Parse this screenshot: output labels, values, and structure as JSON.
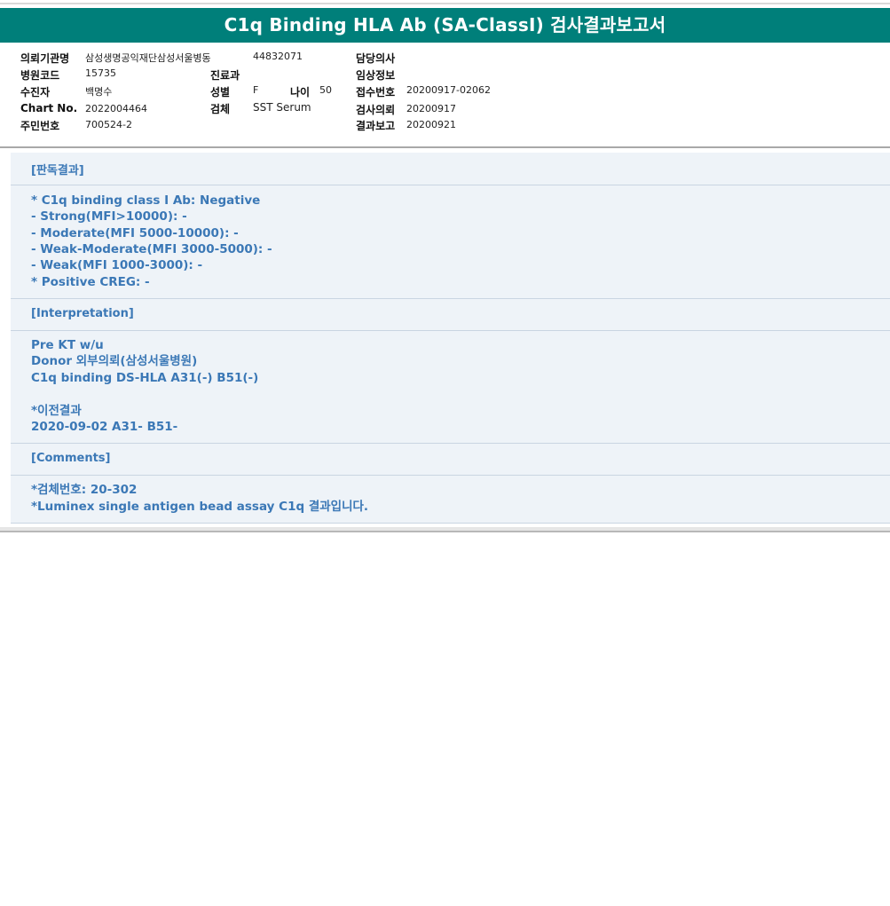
{
  "title": "C1q Binding HLA Ab (SA-ClassI) 검사결과보고서",
  "patient_info": {
    "requesting_institution_label": "의뢰기관명",
    "requesting_institution_value": "삼성생명공익재단삼성서울병동",
    "ward_value": "44832071",
    "doctor_label": "담당의사",
    "doctor_value": "",
    "hospital_code_label": "병원코드",
    "hospital_code_value": "15735",
    "department_label": "진료과",
    "department_value": "",
    "clinical_info_label": "임상정보",
    "clinical_info_value": "",
    "recipient_label": "수진자",
    "recipient_value": "백명수",
    "sex_label": "성별",
    "sex_value": "F",
    "age_label": "나이",
    "age_value": "50",
    "receipt_no_label": "접수번호",
    "receipt_no_value": "20200917-02062",
    "chart_no_label": "Chart No.",
    "chart_no_value": "2022004464",
    "specimen_label": "검체",
    "specimen_value": "SST Serum",
    "test_request_label": "검사의뢰",
    "test_request_value": "20200917",
    "resident_no_label": "주민번호",
    "resident_no_value": "700524-2",
    "result_report_label": "결과보고",
    "result_report_value": "20200921"
  },
  "sections": {
    "result_header": "[판독결과]",
    "result_lines": [
      "* C1q binding class I Ab: Negative",
      "- Strong(MFI>10000): -",
      "- Moderate(MFI 5000-10000): -",
      "- Weak-Moderate(MFI 3000-5000): -",
      "- Weak(MFI 1000-3000): -",
      "* Positive CREG: -"
    ],
    "interpretation_header": "[Interpretation]",
    "interpretation_lines": [
      "Pre KT w/u",
      "Donor 외부의뢰(삼성서울병원)",
      "C1q binding DS-HLA A31(-) B51(-)",
      "",
      "*이전결과",
      "2020-09-02 A31- B51-"
    ],
    "comments_header": "[Comments]",
    "comments_lines": [
      "*검체번호: 20-302",
      "*Luminex single antigen bead assay C1q 결과입니다."
    ]
  }
}
